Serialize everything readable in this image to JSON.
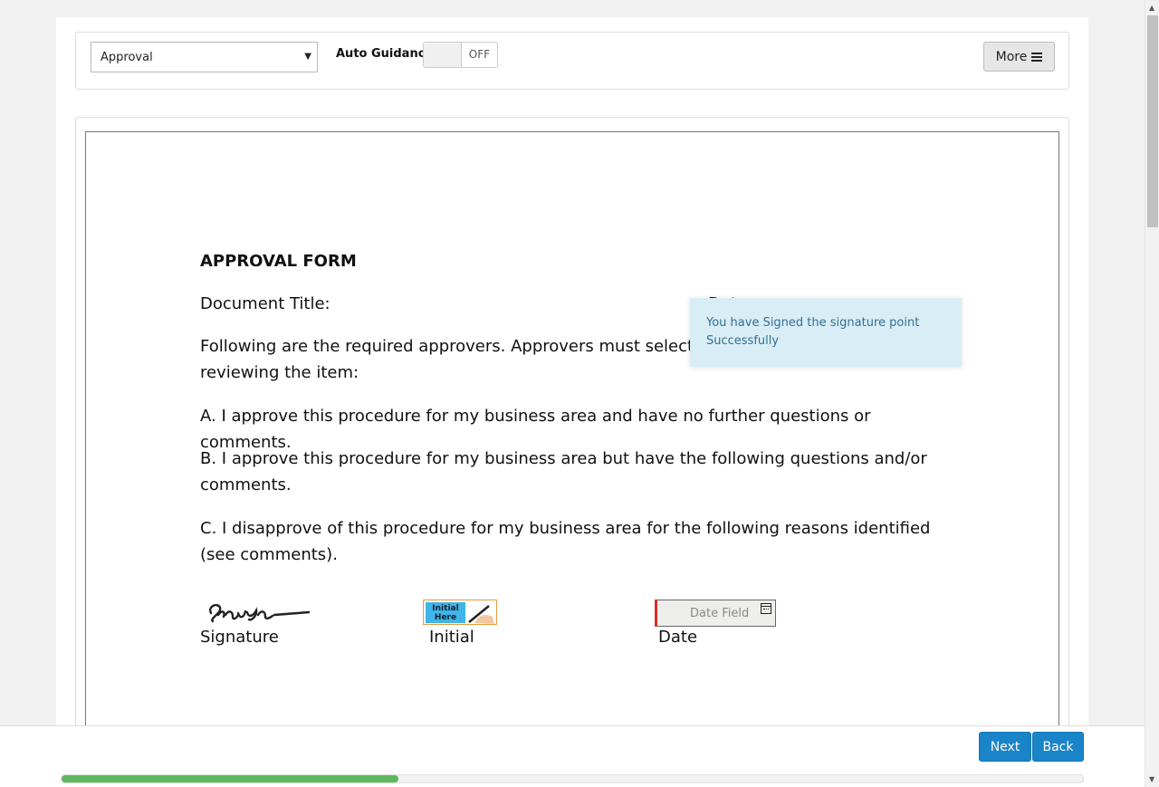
{
  "toolbar": {
    "select_value": "Approval",
    "auto_guidance_label": "Auto Guidance",
    "toggle_state": "OFF",
    "more_label": "More"
  },
  "document": {
    "title": "APPROVAL FORM",
    "document_title_label": "Document Title:",
    "date_partial": "Dat",
    "following": "Following are the required approvers. Approvers must select on",
    "following_cont": "reviewing the item:",
    "option_a": "A. I approve this procedure for my business area and have no further questions or comments.",
    "option_b": "B. I approve this procedure for my business area but have the following questions and/or comments.",
    "option_c": "C. I disapprove of this procedure for my business area for the following reasons identified (see comments).",
    "signature_label": "Signature",
    "initial_label": "Initial",
    "initial_stamp_text": "Initial Here",
    "date_label": "Date",
    "date_field_placeholder": "Date Field"
  },
  "toast": {
    "message": "You have Signed the signature point Successfully"
  },
  "footer": {
    "next_label": "Next",
    "back_label": "Back",
    "progress_percent": 33
  },
  "colors": {
    "primary_button": "#1a84c8",
    "progress_fill": "#5cb85c",
    "toast_bg": "#d9edf7",
    "toast_text": "#31708f",
    "required_marker": "#e02a2a"
  }
}
